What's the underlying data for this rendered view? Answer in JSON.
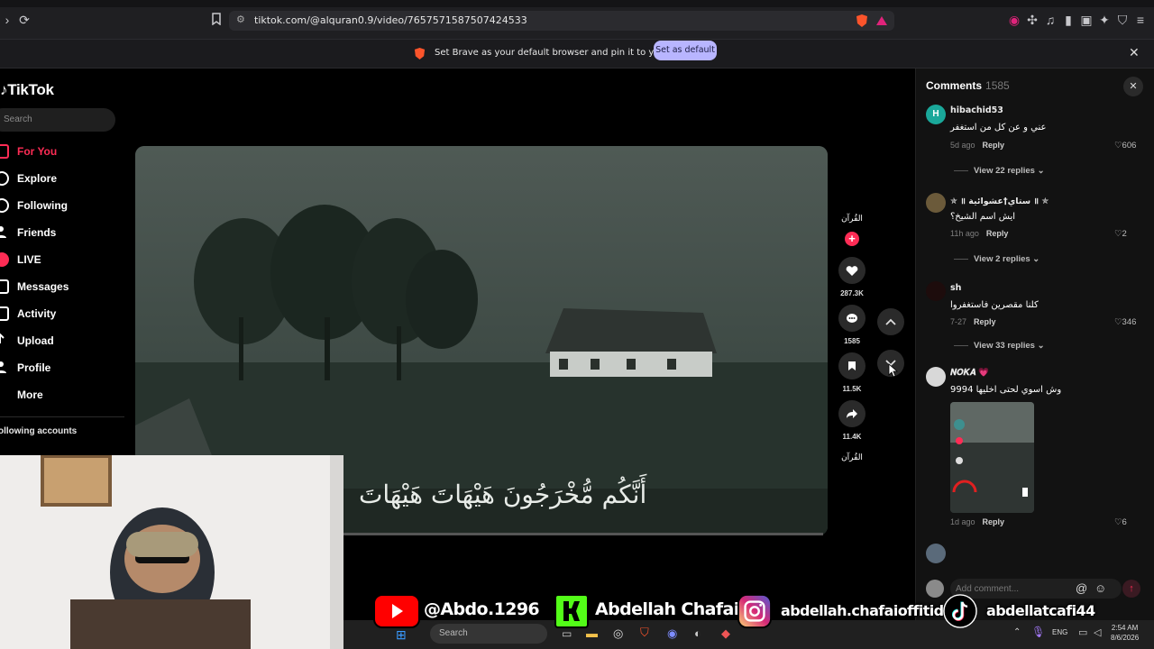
{
  "browser": {
    "url": "tiktok.com/@alquran0.9/video/7657571587507424533",
    "notification_text": "Set Brave as your default browser and pin it to your taskbar",
    "notification_button": "Set as default"
  },
  "tiktok": {
    "logo": "TikTok",
    "search_placeholder": "Search",
    "nav": [
      {
        "label": "For You"
      },
      {
        "label": "Explore"
      },
      {
        "label": "Following"
      },
      {
        "label": "Friends"
      },
      {
        "label": "LIVE"
      },
      {
        "label": "Messages"
      },
      {
        "label": "Activity"
      },
      {
        "label": "Upload"
      },
      {
        "label": "Profile"
      },
      {
        "label": "More"
      }
    ],
    "following_accounts": "ollowing accounts"
  },
  "video": {
    "caption": "أَنَّكُم مُّخْرَجُونَ هَيْهَاتَ هَيْهَاتَ",
    "author_tag": "القُرآن",
    "likes": "287.3K",
    "comments": "1585",
    "saves": "11.5K",
    "shares": "11.4K",
    "music_tag": "القُرآن"
  },
  "comments": {
    "title": "Comments",
    "count": "1585",
    "add_placeholder": "Add comment...",
    "items": [
      {
        "user": "hibachid53",
        "text": "عني و عن كل من استغفر",
        "time": "5d ago",
        "reply": "Reply",
        "likes": "606",
        "view_replies": "View 22 replies"
      },
      {
        "user": "✯ ॥ ستاي†عشوائية ॥ ✯",
        "text": "ايش اسم الشيخ؟",
        "time": "11h ago",
        "reply": "Reply",
        "likes": "2",
        "view_replies": "View 2 replies"
      },
      {
        "user": "sh",
        "text": "كلنا مقصرين فاستغفروا",
        "time": "7-27",
        "reply": "Reply",
        "likes": "346",
        "view_replies": "View 33 replies"
      },
      {
        "user": "𝑵𝑶𝑲𝑨 💗",
        "text": "وش اسوي لحتى اخليها 9994",
        "time": "1d ago",
        "reply": "Reply",
        "likes": "6"
      }
    ]
  },
  "social": {
    "youtube": "@Abdo.1296",
    "kick": "Abdellah Chafai",
    "instagram": "abdellah.chafaioffitid",
    "tiktok": "abdellatcafi44"
  },
  "taskbar": {
    "search": "Search",
    "lang": "ENG",
    "time": "2:54 AM",
    "date": "8/6/2026"
  },
  "colors": {
    "tiktok_red": "#fe2c55",
    "brave_button": "#b8b5ff"
  }
}
